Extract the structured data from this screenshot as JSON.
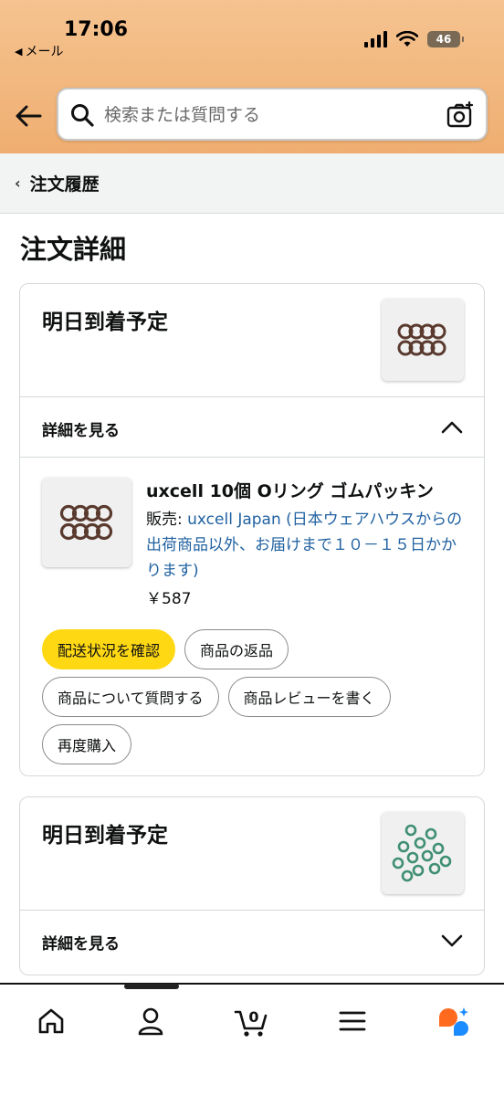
{
  "status_bar": {
    "time": "17:06",
    "back_app": "メール",
    "battery": "46"
  },
  "search": {
    "placeholder": "検索または質問する"
  },
  "breadcrumb": {
    "label": "注文履歴"
  },
  "page": {
    "title": "注文詳細"
  },
  "orders": [
    {
      "delivery_status": "明日到着予定",
      "details_label": "詳細を見る",
      "expanded": true,
      "item": {
        "title": "uxcell 10個 Oリング ゴムパッキン",
        "seller_prefix": "販売: ",
        "seller_name": "uxcell Japan (日本ウェアハウスからの出荷商品以外、お届けまで１０－１５日かかります)",
        "price": "￥587"
      },
      "actions": [
        "配送状況を確認",
        "商品の返品",
        "商品について質問する",
        "商品レビューを書く",
        "再度購入"
      ]
    },
    {
      "delivery_status": "明日到着予定",
      "details_label": "詳細を見る",
      "expanded": false
    }
  ],
  "tabbar": {
    "cart_count": "0",
    "items": [
      "home-icon",
      "account-icon",
      "cart-icon",
      "menu-icon",
      "rufus-icon"
    ]
  },
  "colors": {
    "header_bg": "#efae70",
    "primary_button": "#ffd814",
    "link": "#2162a1",
    "rufus_orange": "#ff6a1f",
    "rufus_blue": "#1a8cff"
  }
}
